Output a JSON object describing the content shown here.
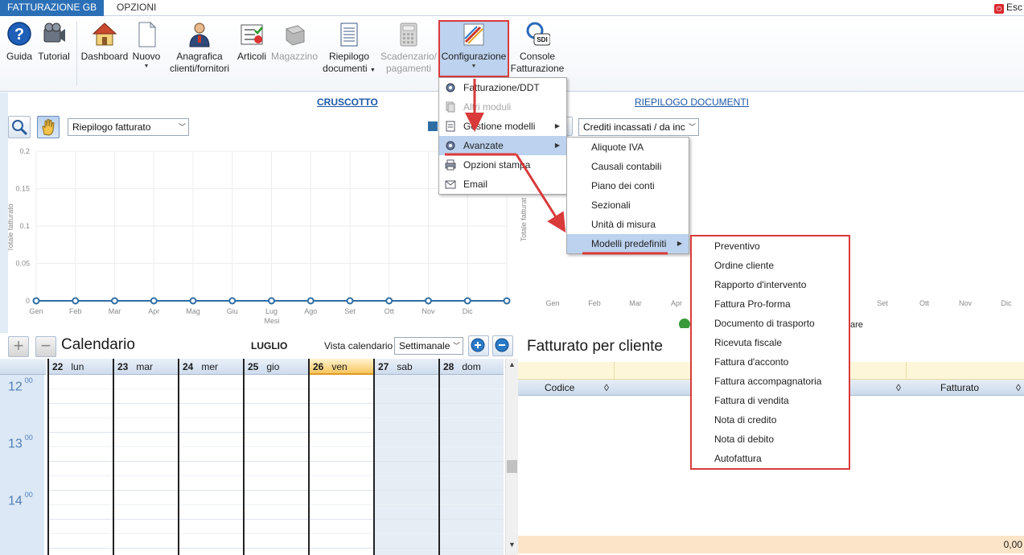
{
  "tabs": [
    {
      "label": "FATTURAZIONE GB",
      "active": true
    },
    {
      "label": "OPZIONI",
      "active": false
    }
  ],
  "exit_label": "Esc",
  "ribbon": {
    "guida": "Guida",
    "tutorial": "Tutorial",
    "dashboard": "Dashboard",
    "nuovo": "Nuovo",
    "anagrafica_1": "Anagrafica",
    "anagrafica_2": "clienti/fornitori",
    "articoli": "Articoli",
    "magazzino": "Magazzino",
    "riepilogo_1": "Riepilogo",
    "riepilogo_2": "documenti",
    "scadenzario_1": "Scadenzario/",
    "scadenzario_2": "pagamenti",
    "configurazione": "Configurazione",
    "console_1": "Console",
    "console_2": "Fatturazione",
    "sdi_badge": "SDI"
  },
  "sections": {
    "cruscotto": "CRUSCOTTO",
    "riepilogo_documenti": "RIEPILOGO DOCUMENTI"
  },
  "dashboard": {
    "left_combo": "Riepilogo fatturato",
    "right_combo": "Crediti incassati / da inc"
  },
  "chart_data": [
    {
      "type": "line",
      "ylabel": "Totale fatturato",
      "xlabel": "Mesi",
      "categories": [
        "Gen",
        "Feb",
        "Mar",
        "Apr",
        "Mag",
        "Giu",
        "Lug",
        "Ago",
        "Set",
        "Ott",
        "Nov",
        "Dic"
      ],
      "y_ticks": [
        "0",
        "0.05",
        "0.1",
        "0.15",
        "0.2"
      ],
      "ylim": [
        0,
        0.2
      ],
      "series": [
        {
          "values": [
            0,
            0,
            0,
            0,
            0,
            0,
            0,
            0,
            0,
            0,
            0,
            0,
            0
          ]
        }
      ],
      "color": "#2e6da4",
      "grid": true
    },
    {
      "type": "line",
      "ylabel": "Totale fatturat",
      "categories_visible": [
        "Gen",
        "Feb",
        "Mar",
        "Apr",
        "Set",
        "Ott",
        "Nov",
        "Dic"
      ],
      "legend_fragment": "are"
    }
  ],
  "calendar": {
    "title": "Calendario",
    "month": "LUGLIO",
    "vista_label": "Vista calendario",
    "vista_value": "Settimanale",
    "days": [
      {
        "num": "22",
        "name": "lun",
        "today": false,
        "weekend": false
      },
      {
        "num": "23",
        "name": "mar",
        "today": false,
        "weekend": false
      },
      {
        "num": "24",
        "name": "mer",
        "today": false,
        "weekend": false
      },
      {
        "num": "25",
        "name": "gio",
        "today": false,
        "weekend": false
      },
      {
        "num": "26",
        "name": "ven",
        "today": true,
        "weekend": false
      },
      {
        "num": "27",
        "name": "sab",
        "today": false,
        "weekend": true
      },
      {
        "num": "28",
        "name": "dom",
        "today": false,
        "weekend": true
      }
    ],
    "hours": [
      {
        "h": "12",
        "m": "00"
      },
      {
        "h": "13",
        "m": "00"
      },
      {
        "h": "14",
        "m": "00"
      }
    ]
  },
  "fatturato_cliente": {
    "title": "Fatturato per cliente",
    "col_codice": "Codice",
    "col_fatturato": "Fatturato",
    "total": "0,00"
  },
  "menu_configurazione": [
    {
      "label": "Fatturazione/DDT",
      "disabled": false,
      "sub": false,
      "icon": "gear-icon"
    },
    {
      "label": "Altri moduli",
      "disabled": true,
      "sub": false,
      "icon": "pages-icon"
    },
    {
      "label": "Gestione modelli",
      "disabled": false,
      "sub": true,
      "icon": "document-icon"
    },
    {
      "label": "Avanzate",
      "disabled": false,
      "sub": true,
      "icon": "gear-icon",
      "highlight": true
    },
    {
      "label": "Opzioni stampa",
      "disabled": false,
      "sub": false,
      "icon": "printer-icon"
    },
    {
      "label": "Email",
      "disabled": false,
      "sub": false,
      "icon": "envelope-icon"
    }
  ],
  "menu_avanzate": [
    {
      "label": "Aliquote IVA"
    },
    {
      "label": "Causali contabili"
    },
    {
      "label": "Piano dei conti"
    },
    {
      "label": "Sezionali"
    },
    {
      "label": "Unità di misura"
    },
    {
      "label": "Modelli predefiniti",
      "highlight": true,
      "sub": true
    }
  ],
  "menu_modelli": [
    {
      "label": "Preventivo"
    },
    {
      "label": "Ordine cliente"
    },
    {
      "label": "Rapporto d'intervento"
    },
    {
      "label": "Fattura Pro-forma"
    },
    {
      "label": "Documento di trasporto"
    },
    {
      "label": "Ricevuta fiscale"
    },
    {
      "label": "Fattura d'acconto"
    },
    {
      "label": "Fattura accompagnatoria"
    },
    {
      "label": "Fattura di vendita"
    },
    {
      "label": "Nota di credito"
    },
    {
      "label": "Nota di debito"
    },
    {
      "label": "Autofattura"
    }
  ]
}
